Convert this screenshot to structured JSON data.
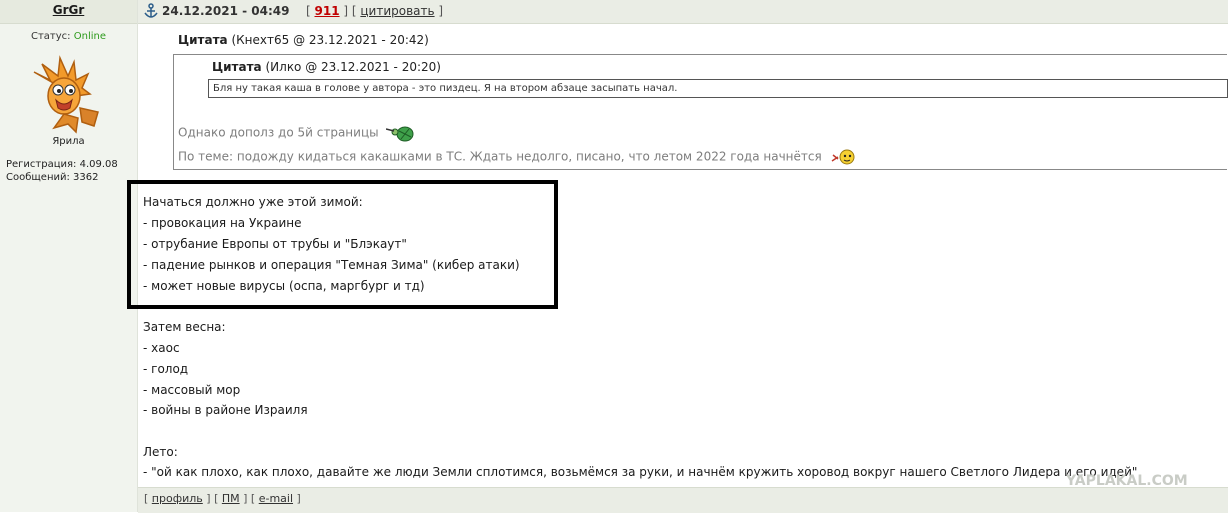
{
  "user": {
    "name": "GrGr",
    "status_label": "Статус:",
    "status_value": "Online",
    "title": "Ярила",
    "registration": "Регистрация: 4.09.08",
    "messages": "Сообщений: 3362"
  },
  "post_header": {
    "date": "24.12.2021 - 04:49",
    "number": "911",
    "quote_label": "цитировать"
  },
  "outer_quote": {
    "label": "Цитата",
    "author": "(Кнехт65 @ 23.12.2021 - 20:42)",
    "inner_quote": {
      "label": "Цитата",
      "author": "(Илко @ 23.12.2021 - 20:20)",
      "text": "Бля ну такая каша в голове у автора - это пиздец. Я на втором абзаце засыпать начал."
    },
    "line1": "Однако дополз до 5й страницы",
    "line2": "По теме: подожду кидаться какашками в ТС. Ждать недолго, писано, что летом 2022 года начнётся"
  },
  "content": {
    "box_lines": [
      "Начаться должно уже этой зимой:",
      "- провокация на Украине",
      "- отрубание Европы от трубы и \"Блэкаут\"",
      "- падение рынков и операция \"Темная Зима\" (кибер атаки)",
      "- может новые вирусы (оспа, маргбург и тд)"
    ],
    "spring_lines": [
      "Затем весна:",
      "- хаос",
      "- голод",
      "- массовый мор",
      "- войны в районе Израиля"
    ],
    "summer_lines": [
      "Лето:",
      "- \"ой как плохо, как плохо, давайте же люди Земли сплотимся, возьмёмся за руки, и начнём кружить хоровод вокруг нашего Светлого Лидера и его идей\""
    ]
  },
  "footer": {
    "profile": "профиль",
    "pm": "ПМ",
    "email": "e-mail"
  },
  "watermark": "YAPLAKAL.COM",
  "icons": {
    "anchor": "anchor-icon",
    "turtle": "turtle-smiley-icon",
    "dog": "dog-smiley-icon"
  }
}
